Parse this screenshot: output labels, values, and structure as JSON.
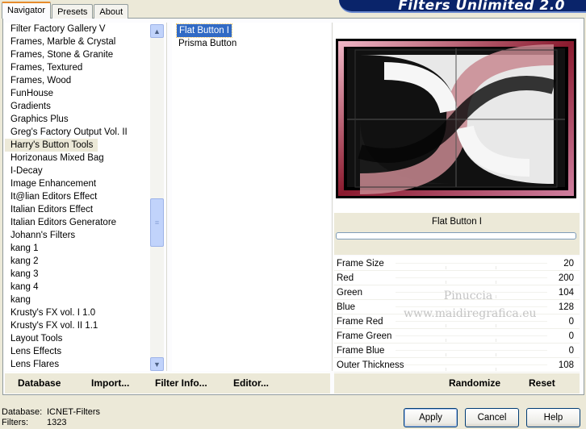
{
  "tabs": [
    "Navigator",
    "Presets",
    "About"
  ],
  "app_title": "Filters Unlimited 2.0",
  "categories": [
    "Filter Factory Gallery V",
    "Frames, Marble & Crystal",
    "Frames, Stone & Granite",
    "Frames, Textured",
    "Frames, Wood",
    "FunHouse",
    "Gradients",
    "Graphics Plus",
    "Greg's Factory Output Vol. II",
    "Harry's Button Tools",
    "Horizonaus Mixed Bag",
    "I-Decay",
    "Image Enhancement",
    "It@lian Editors Effect",
    "Italian Editors Effect",
    "Italian Editors Generatore",
    "Johann's Filters",
    "kang 1",
    "kang 2",
    "kang 3",
    "kang 4",
    "kang",
    "Krusty's FX vol. I 1.0",
    "Krusty's FX vol. II 1.1",
    "Layout Tools",
    "Lens Effects",
    "Lens Flares"
  ],
  "selected_category": "Harry's Button Tools",
  "filters": [
    "Flat Button I",
    "Prisma Button"
  ],
  "selected_filter": "Flat Button I",
  "filter_name": "Flat Button I",
  "params": [
    {
      "name": "Frame Size",
      "value": "20"
    },
    {
      "name": "Red",
      "value": "200"
    },
    {
      "name": "Green",
      "value": "104"
    },
    {
      "name": "Blue",
      "value": "128"
    },
    {
      "name": "Frame Red",
      "value": "0"
    },
    {
      "name": "Frame Green",
      "value": "0"
    },
    {
      "name": "Frame Blue",
      "value": "0"
    },
    {
      "name": "Outer Thickness",
      "value": "108"
    }
  ],
  "watermark": {
    "line1": "Pinuccia",
    "line2": "www.maidiregrafica.eu"
  },
  "toolbar_left": {
    "database": "Database",
    "import": "Import...",
    "filter_info": "Filter Info...",
    "editor": "Editor..."
  },
  "toolbar_right": {
    "randomize": "Randomize",
    "reset": "Reset"
  },
  "status": {
    "database_label": "Database:",
    "database_value": "ICNET-Filters",
    "filters_label": "Filters:",
    "filters_value": "1323"
  },
  "buttons": {
    "apply": "Apply",
    "cancel": "Cancel",
    "help": "Help"
  },
  "colors": {
    "preview_tint": "#c86880",
    "frame_red": "#8a1a2e",
    "selection_blue": "#316ac5"
  }
}
